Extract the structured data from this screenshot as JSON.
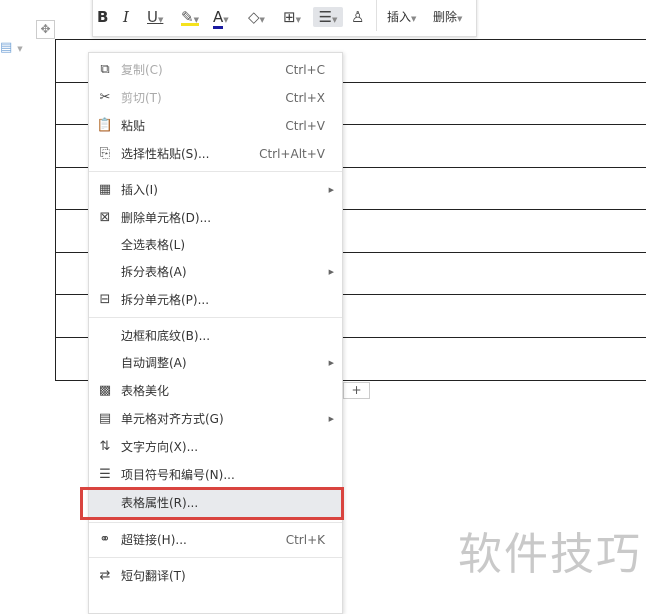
{
  "toolbar": {
    "bold": "B",
    "italic": "I",
    "underline": "U",
    "font_color": "A",
    "insert": "插入",
    "delete": "删除"
  },
  "menu": {
    "items": [
      {
        "label": "复制(C)",
        "shortcut": "Ctrl+C",
        "icon": "copy-icon",
        "disabled": true
      },
      {
        "label": "剪切(T)",
        "shortcut": "Ctrl+X",
        "icon": "cut-icon",
        "disabled": true
      },
      {
        "label": "粘贴",
        "shortcut": "Ctrl+V",
        "icon": "paste-icon"
      },
      {
        "label": "选择性粘贴(S)...",
        "shortcut": "Ctrl+Alt+V",
        "icon": "paste-special-icon"
      },
      {
        "label": "插入(I)",
        "icon": "table-insert-icon",
        "submenu": true
      },
      {
        "label": "删除单元格(D)...",
        "icon": "delete-cell-icon"
      },
      {
        "label": "全选表格(L)"
      },
      {
        "label": "拆分表格(A)",
        "submenu": true
      },
      {
        "label": "拆分单元格(P)...",
        "icon": "split-cell-icon"
      },
      {
        "label": "边框和底纹(B)..."
      },
      {
        "label": "自动调整(A)",
        "submenu": true
      },
      {
        "label": "表格美化",
        "icon": "table-style-icon"
      },
      {
        "label": "单元格对齐方式(G)",
        "icon": "align-icon",
        "submenu": true
      },
      {
        "label": "文字方向(X)...",
        "icon": "text-direction-icon"
      },
      {
        "label": "项目符号和编号(N)...",
        "icon": "list-icon"
      },
      {
        "label": "表格属性(R)...",
        "highlighted": true
      },
      {
        "label": "超链接(H)...",
        "shortcut": "Ctrl+K",
        "icon": "link-icon"
      },
      {
        "label": "短句翻译(T)",
        "icon": "translate-icon"
      }
    ]
  },
  "watermark": "软件技巧"
}
